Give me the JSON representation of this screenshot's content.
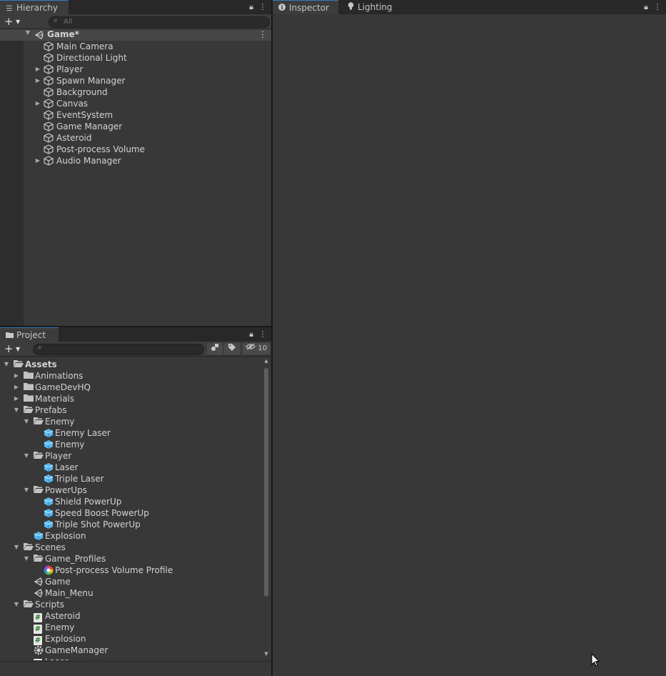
{
  "hierarchy": {
    "tab_label": "Hierarchy",
    "search_placeholder": "All",
    "scene_name": "Game*",
    "items": [
      {
        "label": "Main Camera",
        "expandable": false
      },
      {
        "label": "Directional Light",
        "expandable": false
      },
      {
        "label": "Player",
        "expandable": true
      },
      {
        "label": "Spawn Manager",
        "expandable": true
      },
      {
        "label": "Background",
        "expandable": false
      },
      {
        "label": "Canvas",
        "expandable": true
      },
      {
        "label": "EventSystem",
        "expandable": false
      },
      {
        "label": "Game Manager",
        "expandable": false
      },
      {
        "label": "Asteroid",
        "expandable": false
      },
      {
        "label": "Post-process Volume",
        "expandable": false
      },
      {
        "label": "Audio Manager",
        "expandable": true
      }
    ]
  },
  "inspector": {
    "tabs": [
      {
        "label": "Inspector",
        "icon": "info-icon"
      },
      {
        "label": "Lighting",
        "icon": "lightbulb-icon"
      }
    ]
  },
  "project": {
    "tab_label": "Project",
    "hidden_count": "10",
    "tree": [
      {
        "label": "Assets",
        "depth": 0,
        "arrow": "open",
        "icon": "folder-open",
        "bold": true
      },
      {
        "label": "Animations",
        "depth": 1,
        "arrow": "closed",
        "icon": "folder"
      },
      {
        "label": "GameDevHQ",
        "depth": 1,
        "arrow": "closed",
        "icon": "folder"
      },
      {
        "label": "Materials",
        "depth": 1,
        "arrow": "closed",
        "icon": "folder"
      },
      {
        "label": "Prefabs",
        "depth": 1,
        "arrow": "open",
        "icon": "folder-open"
      },
      {
        "label": "Enemy",
        "depth": 2,
        "arrow": "open",
        "icon": "folder-open"
      },
      {
        "label": "Enemy Laser",
        "depth": 3,
        "arrow": "",
        "icon": "prefab"
      },
      {
        "label": "Enemy",
        "depth": 3,
        "arrow": "",
        "icon": "prefab"
      },
      {
        "label": "Player",
        "depth": 2,
        "arrow": "open",
        "icon": "folder-open"
      },
      {
        "label": "Laser",
        "depth": 3,
        "arrow": "",
        "icon": "prefab"
      },
      {
        "label": "Triple Laser",
        "depth": 3,
        "arrow": "",
        "icon": "prefab"
      },
      {
        "label": "PowerUps",
        "depth": 2,
        "arrow": "open",
        "icon": "folder-open"
      },
      {
        "label": "Shield PowerUp",
        "depth": 3,
        "arrow": "",
        "icon": "prefab"
      },
      {
        "label": "Speed Boost PowerUp",
        "depth": 3,
        "arrow": "",
        "icon": "prefab"
      },
      {
        "label": "Triple Shot PowerUp",
        "depth": 3,
        "arrow": "",
        "icon": "prefab"
      },
      {
        "label": "Explosion",
        "depth": 2,
        "arrow": "",
        "icon": "prefab"
      },
      {
        "label": "Scenes",
        "depth": 1,
        "arrow": "open",
        "icon": "folder-open"
      },
      {
        "label": "Game_Profiles",
        "depth": 2,
        "arrow": "open",
        "icon": "folder-open"
      },
      {
        "label": "Post-process Volume Profile",
        "depth": 3,
        "arrow": "",
        "icon": "postprocess"
      },
      {
        "label": "Game",
        "depth": 2,
        "arrow": "",
        "icon": "scene"
      },
      {
        "label": "Main_Menu",
        "depth": 2,
        "arrow": "",
        "icon": "scene"
      },
      {
        "label": "Scripts",
        "depth": 1,
        "arrow": "open",
        "icon": "folder-open"
      },
      {
        "label": "Asteroid",
        "depth": 2,
        "arrow": "",
        "icon": "script"
      },
      {
        "label": "Enemy",
        "depth": 2,
        "arrow": "",
        "icon": "script"
      },
      {
        "label": "Explosion",
        "depth": 2,
        "arrow": "",
        "icon": "script"
      },
      {
        "label": "GameManager",
        "depth": 2,
        "arrow": "",
        "icon": "gear"
      },
      {
        "label": "Laser",
        "depth": 2,
        "arrow": "",
        "icon": "script"
      }
    ]
  }
}
